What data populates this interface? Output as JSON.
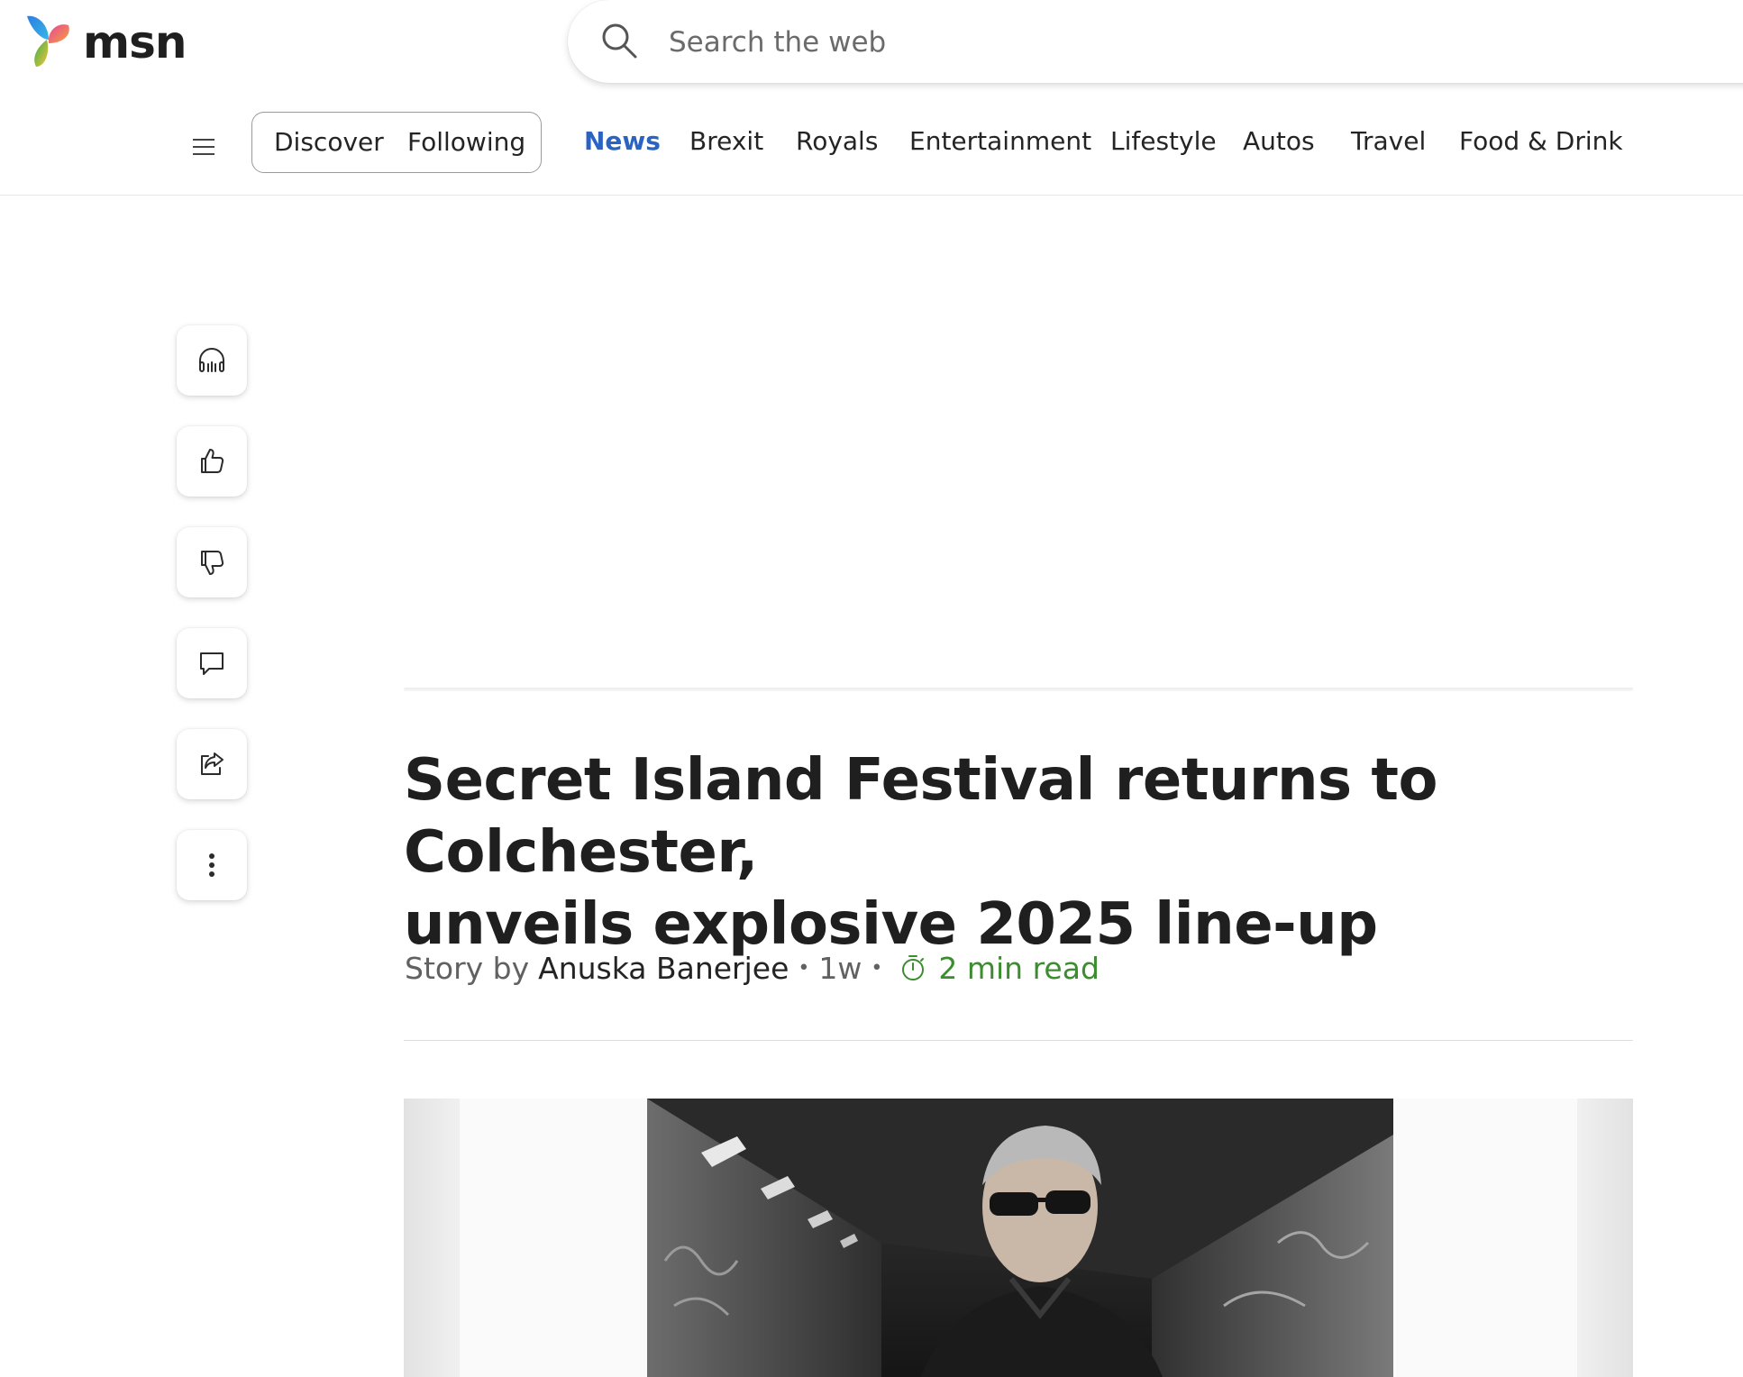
{
  "header": {
    "logo_text": "msn",
    "search_placeholder": "Search the web"
  },
  "nav": {
    "segments": [
      "Discover",
      "Following"
    ],
    "links": [
      "News",
      "Brexit",
      "Royals",
      "Entertainment",
      "Lifestyle",
      "Autos",
      "Travel",
      "Food & Drink"
    ],
    "active_link": "News",
    "active_color": "#2b63c3"
  },
  "rail": {
    "buttons": [
      "headphones-icon",
      "thumbs-up-icon",
      "thumbs-down-icon",
      "comment-icon",
      "share-icon",
      "more-icon"
    ]
  },
  "article": {
    "headline_line1": "Secret Island Festival returns to Colchester,",
    "headline_line2": "unveils explosive 2025 line-up",
    "story_by": "Story by",
    "author": "Anuska Banerjee",
    "age": "1w",
    "read_time": "2 min read",
    "read_time_color": "#3b8d2f"
  }
}
